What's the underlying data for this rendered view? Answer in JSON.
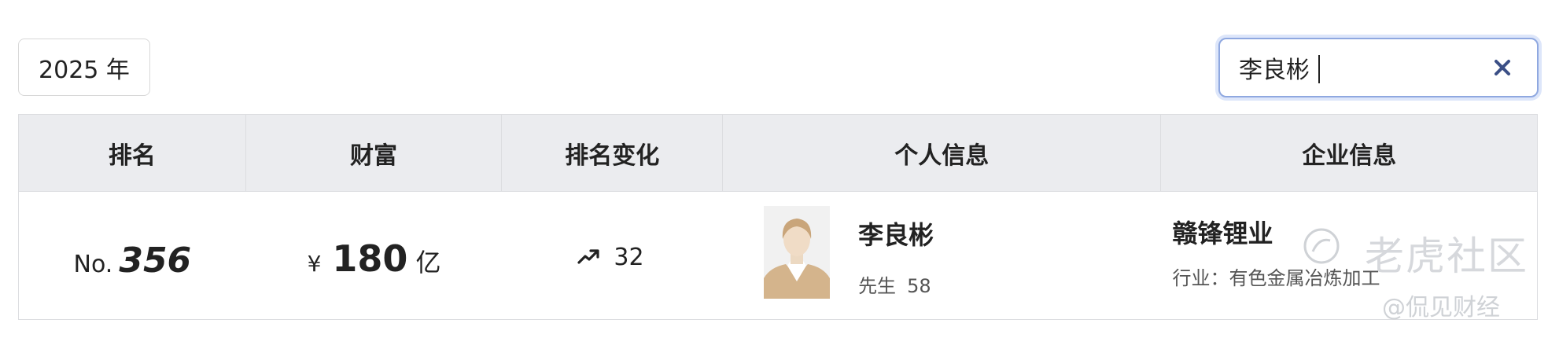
{
  "filters": {
    "year_label": "2025 年",
    "search_value": "李良彬"
  },
  "table": {
    "headers": [
      "排名",
      "财富",
      "排名变化",
      "个人信息",
      "企业信息"
    ],
    "rows": [
      {
        "rank_prefix": "No.",
        "rank_number": "356",
        "currency": "¥",
        "wealth_amount": "180",
        "wealth_unit": "亿",
        "rank_change": "32",
        "rank_change_direction": "up",
        "person_name": "李良彬",
        "person_title": "先生",
        "person_age": "58",
        "company_name": "赣锋锂业",
        "industry": "行业：有色金属冶炼加工"
      }
    ]
  },
  "watermark": {
    "brand": "老虎社区",
    "handle": "@侃见财经"
  },
  "colors": {
    "header_bg": "#ebecef",
    "border": "#dcdde0",
    "focus_ring": "#8fa8e0",
    "clear_icon": "#3b4f86",
    "avatar_shirt": "#d4b48c"
  }
}
